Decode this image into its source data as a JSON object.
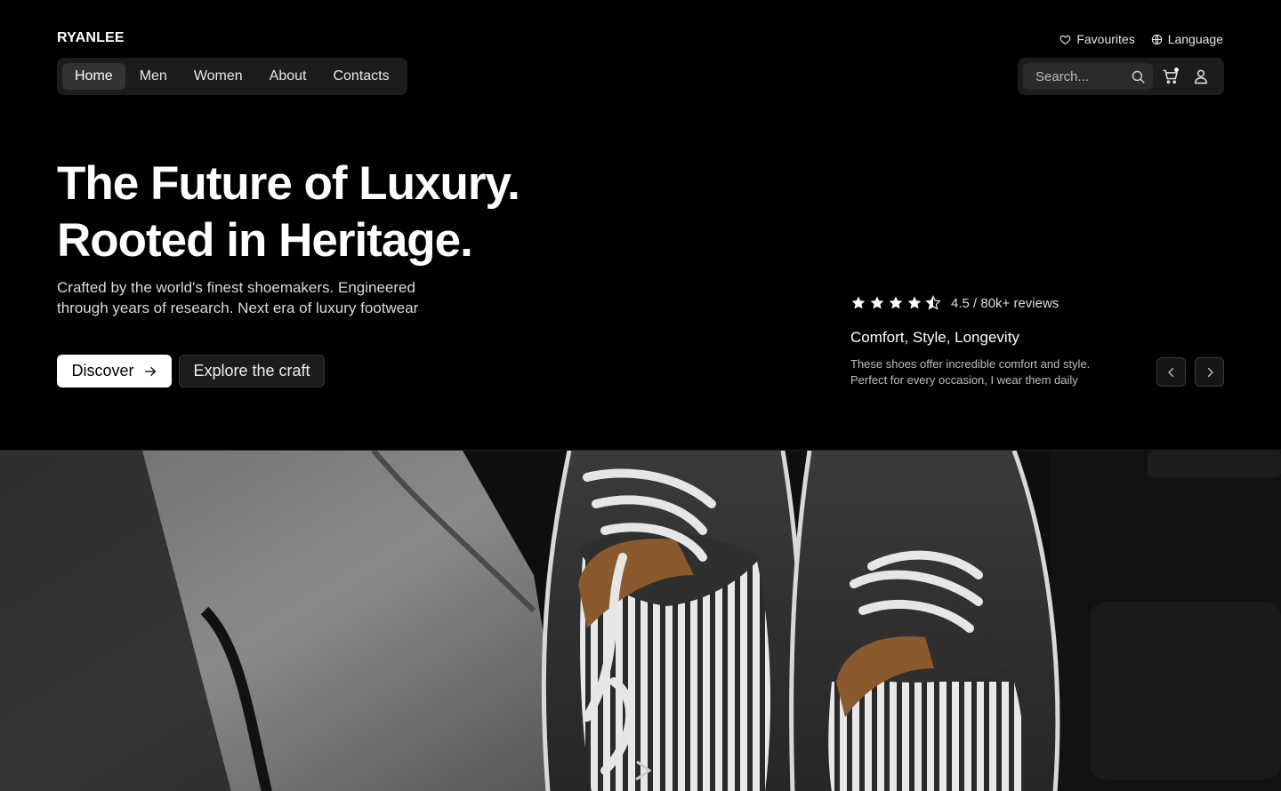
{
  "brand": "RYANLEE",
  "top_links": {
    "favourites": "Favourites",
    "language": "Language"
  },
  "nav": [
    {
      "label": "Home",
      "active": true
    },
    {
      "label": "Men"
    },
    {
      "label": "Women"
    },
    {
      "label": "About"
    },
    {
      "label": "Contacts"
    }
  ],
  "search": {
    "placeholder": "Search..."
  },
  "icons": {
    "search": "search-icon",
    "cart": "cart-icon",
    "user": "user-icon",
    "heart": "heart-icon",
    "globe": "globe-icon"
  },
  "hero": {
    "title_line1": "The Future of Luxury.",
    "title_line2": "Rooted in Heritage.",
    "subtitle": "Crafted by the world's finest shoemakers. Engineered through years of research. Next era of luxury footwear",
    "discover_label": "Discover",
    "explore_label": "Explore the craft"
  },
  "review": {
    "stars": 4.5,
    "rating_text": "4.5 / 80k+ reviews",
    "title": "Comfort, Style, Longevity",
    "text": "These shoes offer incredible comfort and style. Perfect for every occasion, I wear them daily"
  },
  "colors": {
    "background": "#000000",
    "panel": "#1c1c1c",
    "accent": "#ffffff"
  }
}
